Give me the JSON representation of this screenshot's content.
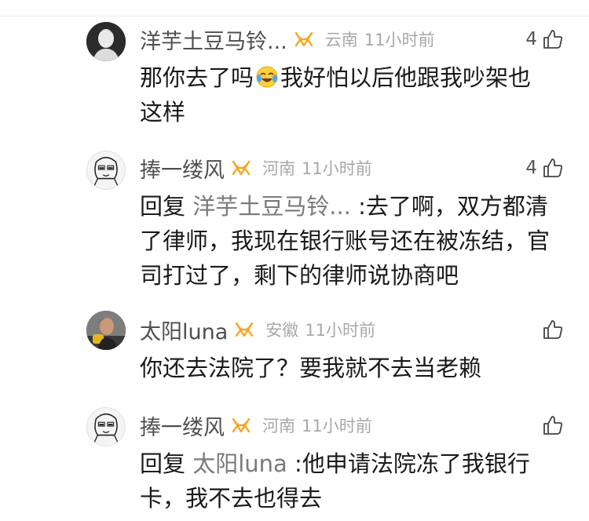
{
  "comments": [
    {
      "username": "洋芋土豆马铃...",
      "location": "云南",
      "time": "11小时前",
      "likes": "4",
      "text_a": "那你去了吗",
      "emoji": "crying-laughing-emoji",
      "text_b": "我好怕以后他跟我吵架也",
      "text_c": "这样"
    },
    {
      "username": "捧一缕风",
      "location": "河南",
      "time": "11小时前",
      "likes": "4",
      "reply_prefix": "回复",
      "reply_to": "洋芋土豆马铃...",
      "text": ":去了啊，双方都清了律师，我现在银行账号还在被冻结，官司打过了，剩下的律师说协商吧"
    },
    {
      "username": "太阳luna",
      "location": "安徽",
      "time": "11小时前",
      "likes": "",
      "text": "你还去法院了？要我就不去当老赖"
    },
    {
      "username": "捧一缕风",
      "location": "河南",
      "time": "11小时前",
      "likes": "",
      "reply_prefix": "回复",
      "reply_to": "太阳luna",
      "text": ":他申请法院冻了我银行卡，我不去也得去"
    }
  ],
  "colors": {
    "vip_badge": "#f5a623",
    "meta_text": "#a8a8a8",
    "username_text": "#4f4f4f"
  }
}
